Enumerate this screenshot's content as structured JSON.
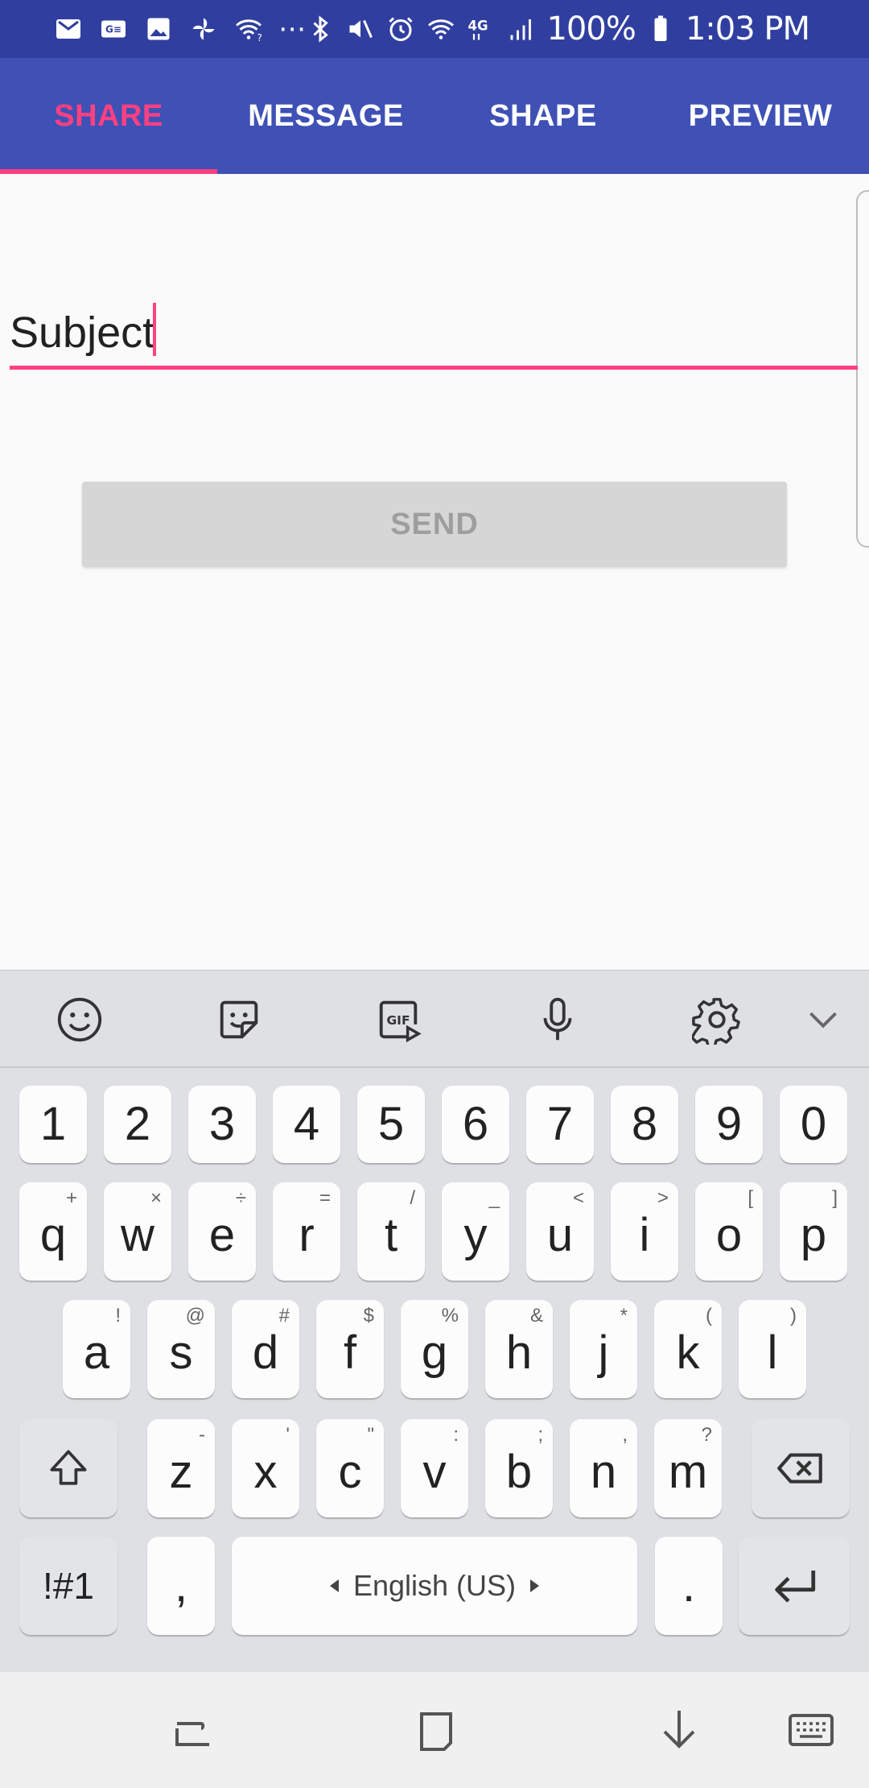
{
  "status_bar": {
    "icons_left": [
      "gmail-icon",
      "card-icon",
      "image-icon",
      "pinwheel-icon",
      "wifi-question-icon"
    ],
    "more": "⋯",
    "icons_right": [
      "bluetooth-icon",
      "mute-icon",
      "alarm-icon",
      "wifi-calling-icon",
      "lte-icon",
      "signal-icon"
    ],
    "battery": "100%",
    "time": "1:03 PM"
  },
  "tabs": [
    {
      "label": "SHARE",
      "active": true
    },
    {
      "label": "MESSAGE",
      "active": false
    },
    {
      "label": "SHAPE",
      "active": false
    },
    {
      "label": "PREVIEW",
      "active": false
    }
  ],
  "form": {
    "subject_value": "Subject",
    "send_label": "SEND"
  },
  "keyboard": {
    "toolbar": [
      "emoji-icon",
      "sticker-icon",
      "gif-icon",
      "microphone-icon",
      "settings-gear-icon",
      "chevron-down-icon"
    ],
    "number_row": [
      "1",
      "2",
      "3",
      "4",
      "5",
      "6",
      "7",
      "8",
      "9",
      "0"
    ],
    "row1": [
      {
        "key": "q",
        "sup": "+"
      },
      {
        "key": "w",
        "sup": "×"
      },
      {
        "key": "e",
        "sup": "÷"
      },
      {
        "key": "r",
        "sup": "="
      },
      {
        "key": "t",
        "sup": "/"
      },
      {
        "key": "y",
        "sup": "_"
      },
      {
        "key": "u",
        "sup": "<"
      },
      {
        "key": "i",
        "sup": ">"
      },
      {
        "key": "o",
        "sup": "["
      },
      {
        "key": "p",
        "sup": "]"
      }
    ],
    "row2": [
      {
        "key": "a",
        "sup": "!"
      },
      {
        "key": "s",
        "sup": "@"
      },
      {
        "key": "d",
        "sup": "#"
      },
      {
        "key": "f",
        "sup": "$"
      },
      {
        "key": "g",
        "sup": "%"
      },
      {
        "key": "h",
        "sup": "&"
      },
      {
        "key": "j",
        "sup": "*"
      },
      {
        "key": "k",
        "sup": "("
      },
      {
        "key": "l",
        "sup": ")"
      }
    ],
    "row3": [
      {
        "key": "z",
        "sup": "-"
      },
      {
        "key": "x",
        "sup": "'"
      },
      {
        "key": "c",
        "sup": "\""
      },
      {
        "key": "v",
        "sup": ":"
      },
      {
        "key": "b",
        "sup": ";"
      },
      {
        "key": "n",
        "sup": ","
      },
      {
        "key": "m",
        "sup": "?"
      }
    ],
    "symbols_label": "!#1",
    "comma": ",",
    "space_label": "English (US)",
    "period": "."
  },
  "nav_bar": [
    "recents-icon",
    "home-icon",
    "back-icon",
    "keyboard-switch-icon"
  ],
  "colors": {
    "status_bar": "#303f9f",
    "primary": "#3f51b5",
    "accent": "#ff4081"
  }
}
